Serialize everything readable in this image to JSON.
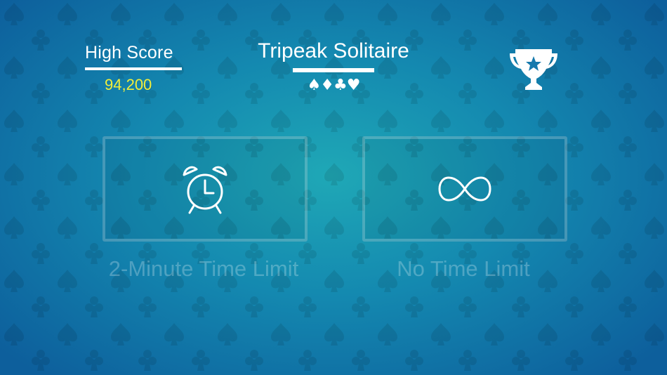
{
  "header": {
    "high_score_label": "High Score",
    "high_score_value": "94,200",
    "title": "Tripeak Solitaire",
    "suits": "♠♦♣♥"
  },
  "icons": {
    "trophy": "trophy-icon",
    "timed_mode": "alarm-clock-icon",
    "untimed_mode": "infinity-icon"
  },
  "modes": {
    "timed_label": "2-Minute Time Limit",
    "untimed_label": "No Time Limit"
  },
  "colors": {
    "accent_score": "#f1ee3a",
    "background": "#1489b0"
  }
}
